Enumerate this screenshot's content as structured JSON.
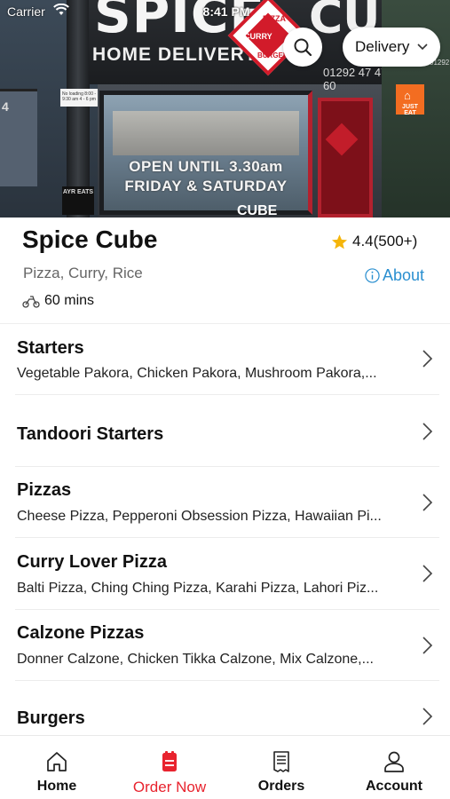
{
  "status_bar": {
    "carrier": "Carrier",
    "time": "8:41 PM"
  },
  "hero_photo": {
    "sign_brand": "SPICE",
    "sign_brand_suffix": "CUBE",
    "sign_subtitle": "HOME DELIVERY",
    "sign_phone": "01292 47 47 60",
    "sign_diamond": [
      "PIZZA",
      "CURRY",
      "BURGER"
    ],
    "window_text": [
      "OPEN UNTIL 3.30am",
      "FRIDAY & SATURDAY"
    ],
    "lamp_sign": "AYR EATS",
    "shop_number": "4",
    "notice": "No loading 8:00 - 9:30 am 4 - 6 pm",
    "just_eat": "JUST EAT",
    "right_number": "01292"
  },
  "header": {
    "delivery_mode": "Delivery"
  },
  "restaurant": {
    "name": "Spice Cube",
    "rating": "4.4(500+)",
    "cuisines": "Pizza, Curry, Rice",
    "about_label": "About",
    "delivery_time": "60 mins"
  },
  "categories": [
    {
      "title": "Starters",
      "items": "Vegetable Pakora, Chicken Pakora, Mushroom Pakora,..."
    },
    {
      "title": "Tandoori Starters",
      "items": ""
    },
    {
      "title": "Pizzas",
      "items": "Cheese Pizza, Pepperoni Obsession Pizza, Hawaiian Pi..."
    },
    {
      "title": "Curry Lover Pizza",
      "items": "Balti Pizza, Ching Ching Pizza, Karahi Pizza, Lahori Piz..."
    },
    {
      "title": "Calzone Pizzas",
      "items": "Donner Calzone, Chicken Tikka Calzone, Mix Calzone,..."
    },
    {
      "title": "Burgers",
      "items": ""
    }
  ],
  "tabs": [
    {
      "label": "Home",
      "icon": "home-icon"
    },
    {
      "label": "Order Now",
      "icon": "order-icon"
    },
    {
      "label": "Orders",
      "icon": "receipt-icon"
    },
    {
      "label": "Account",
      "icon": "person-icon"
    }
  ],
  "colors": {
    "accent_red": "#e8232e",
    "link_blue": "#2a8fd0",
    "star_gold": "#f5b50a",
    "text_gray": "#666666"
  }
}
